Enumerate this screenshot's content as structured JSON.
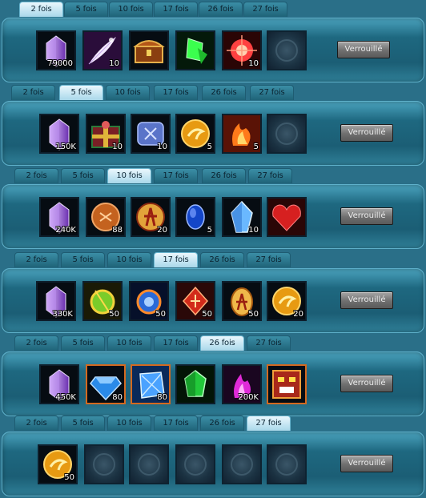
{
  "tab_labels": [
    "2 fois",
    "5 fois",
    "10 fois",
    "17 fois",
    "26 fois",
    "27 fois"
  ],
  "sections": [
    {
      "active_tab": 0,
      "button_label": "Verrouillé",
      "items": [
        {
          "icon": "purple-crystal-icon",
          "qty": "79000"
        },
        {
          "icon": "white-feather-icon",
          "qty": "10"
        },
        {
          "icon": "treasure-chest-icon",
          "qty": ""
        },
        {
          "icon": "green-gem-shard-icon",
          "qty": ""
        },
        {
          "icon": "red-orb-icon",
          "qty": "10"
        },
        {
          "icon": "empty-slot-icon",
          "qty": ""
        }
      ]
    },
    {
      "active_tab": 1,
      "button_label": "Verrouillé",
      "items": [
        {
          "icon": "purple-crystal-icon",
          "qty": "150K"
        },
        {
          "icon": "gift-box-icon",
          "qty": "10"
        },
        {
          "icon": "blue-rune-stone-icon",
          "qty": "10"
        },
        {
          "icon": "gold-coin-icon",
          "qty": "5"
        },
        {
          "icon": "fire-scroll-icon",
          "qty": "5"
        },
        {
          "icon": "empty-slot-icon",
          "qty": ""
        }
      ]
    },
    {
      "active_tab": 2,
      "button_label": "Verrouillé",
      "items": [
        {
          "icon": "purple-crystal-icon",
          "qty": "240K"
        },
        {
          "icon": "bronze-coin-icon",
          "qty": "88"
        },
        {
          "icon": "warrior-emblem-icon",
          "qty": "20"
        },
        {
          "icon": "blue-sapphire-icon",
          "qty": "5"
        },
        {
          "icon": "blue-crystal-icon",
          "qty": "10"
        },
        {
          "icon": "red-heart-gem-icon",
          "qty": ""
        }
      ]
    },
    {
      "active_tab": 3,
      "button_label": "Verrouillé",
      "items": [
        {
          "icon": "purple-crystal-icon",
          "qty": "330K"
        },
        {
          "icon": "green-fire-orb-icon",
          "qty": "50"
        },
        {
          "icon": "blue-fire-orb-icon",
          "qty": "50"
        },
        {
          "icon": "red-rune-icon",
          "qty": "50"
        },
        {
          "icon": "warrior-egg-icon",
          "qty": "50"
        },
        {
          "icon": "gold-coin-icon",
          "qty": "20"
        }
      ]
    },
    {
      "active_tab": 4,
      "button_label": "Verrouillé",
      "items": [
        {
          "icon": "purple-crystal-icon",
          "qty": "450K"
        },
        {
          "icon": "blue-diamond-icon",
          "qty": "80"
        },
        {
          "icon": "blue-ice-crystal-icon",
          "qty": "80"
        },
        {
          "icon": "green-emerald-icon",
          "qty": ""
        },
        {
          "icon": "magenta-flame-icon",
          "qty": "200K"
        },
        {
          "icon": "tiki-mask-icon",
          "qty": ""
        }
      ]
    },
    {
      "active_tab": 5,
      "button_label": "Verrouillé",
      "items": [
        {
          "icon": "gold-coin-icon",
          "qty": "50"
        },
        {
          "icon": "empty-slot-icon",
          "qty": ""
        },
        {
          "icon": "empty-slot-icon",
          "qty": ""
        },
        {
          "icon": "empty-slot-icon",
          "qty": ""
        },
        {
          "icon": "empty-slot-icon",
          "qty": ""
        },
        {
          "icon": "empty-slot-icon",
          "qty": ""
        }
      ]
    }
  ]
}
